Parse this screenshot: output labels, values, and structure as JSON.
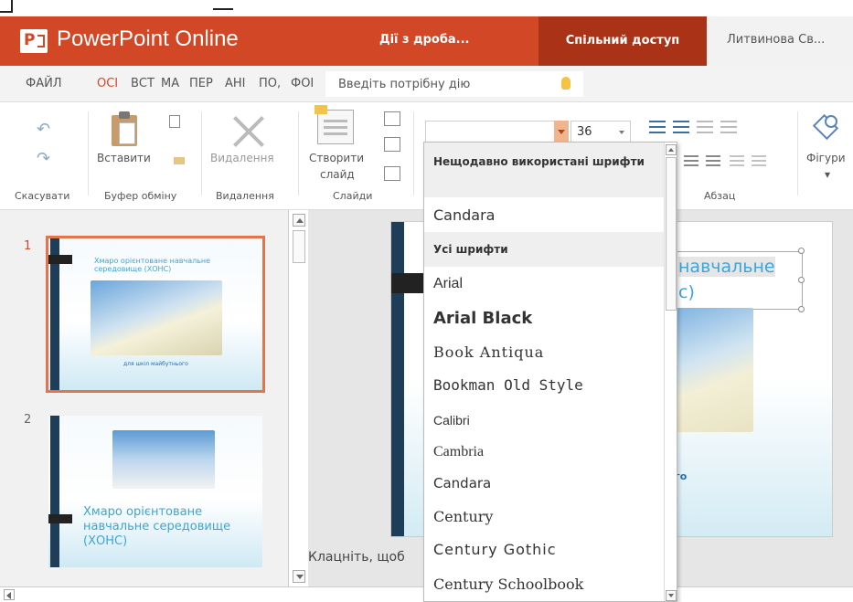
{
  "app": {
    "title": "PowerPoint Online",
    "logo_letter": "P"
  },
  "header": {
    "edit_action": "Дії з дроба...",
    "share_button": "Спільний доступ",
    "user_name": "Литвинова Св..."
  },
  "tabs": [
    {
      "label": "ФАЙЛ"
    },
    {
      "label": "ОСІ"
    },
    {
      "label": "ВСТ"
    },
    {
      "label": "МА"
    },
    {
      "label": "ПЕР"
    },
    {
      "label": "АНІ"
    },
    {
      "label": "ПО,"
    },
    {
      "label": "ФОІ"
    }
  ],
  "tell_me": {
    "placeholder": "Введіть потрібну дію"
  },
  "ribbon": {
    "undo_group": "Скасувати",
    "paste_button": "Вставити",
    "clipboard_group": "Буфер обміну",
    "delete_button": "Видалення",
    "delete_group": "Видалення",
    "new_slide_button_line1": "Створити",
    "new_slide_button_line2": "слайд",
    "slides_group": "Слайди",
    "font_size": "36",
    "paragraph_group": "Абзац",
    "shapes_button": "Фігури"
  },
  "slides": [
    {
      "number": "1",
      "title": "Хмаро орієнтоване навчальне середовище (ХОНС)",
      "subtitle": "для шкіл майбутнього"
    },
    {
      "number": "2",
      "title": "Хмаро орієнтоване навчальне середовище (ХОНС)"
    }
  ],
  "main_slide": {
    "title_line1": "навчальне",
    "title_line2": "с)",
    "subtitle_fragment": "го"
  },
  "notes": {
    "placeholder": "Клацніть, щоб"
  },
  "font_dropdown": {
    "recent_header": "Нещодавно використані шрифти",
    "recent": [
      "Candara"
    ],
    "all_header": "Усі шрифти",
    "fonts": [
      "Arial",
      "Arial Black",
      "Book Antiqua",
      "Bookman Old Style",
      "Calibri",
      "Cambria",
      "Candara",
      "Century",
      "Century Gothic",
      "Century Schoolbook"
    ]
  },
  "colors": {
    "brand": "#d24726",
    "share_bg": "#a93217",
    "slide_title": "#3da5d8",
    "slide_dark_bar": "#1e3d59"
  }
}
